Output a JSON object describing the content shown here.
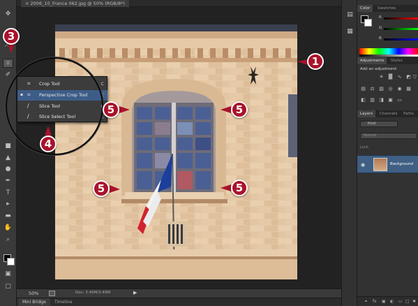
{
  "document": {
    "tab_title": "2006_10_France 062.jpg @ 50% (RGB/8*)",
    "tab_close": "×"
  },
  "status": {
    "zoom": "50%",
    "doc_size": "Doc: 3.49M/3.49M",
    "arrow": "▶"
  },
  "bottom_tabs": [
    "Mini Bridge",
    "Timeline"
  ],
  "crop_flyout": {
    "items": [
      {
        "label": "Crop Tool",
        "key": "C",
        "icon": "crop-icon",
        "glyph": "⌗",
        "selected": false
      },
      {
        "label": "Perspective Crop Tool",
        "key": "C",
        "icon": "perspective-crop-icon",
        "glyph": "⌗",
        "selected": true
      },
      {
        "label": "Slice Tool",
        "key": "C",
        "icon": "slice-icon",
        "glyph": "∕",
        "selected": false
      },
      {
        "label": "Slice Select Tool",
        "key": "C",
        "icon": "slice-select-icon",
        "glyph": "∕",
        "selected": false
      }
    ],
    "bullet": "▪"
  },
  "callouts": [
    "1",
    "3",
    "4",
    "5",
    "5",
    "5",
    "5"
  ],
  "panels": {
    "color_tabs": [
      "Color",
      "Swatches"
    ],
    "color_sliders": [
      "R",
      "G",
      "B"
    ],
    "adjustment_tabs": [
      "Adjustments",
      "Styles"
    ],
    "adjustment_title": "Add an adjustment",
    "layer_tabs": [
      "Layers",
      "Channels",
      "Paths"
    ],
    "kind_filter": "Kind",
    "blend_mode": "Normal",
    "lock_label": "Lock:",
    "layer_name": "Background",
    "eye": "👁"
  },
  "colors": {
    "callout": "#a9132b",
    "highlight": "#3d5d88",
    "layer_selected": "#3f5f84"
  }
}
